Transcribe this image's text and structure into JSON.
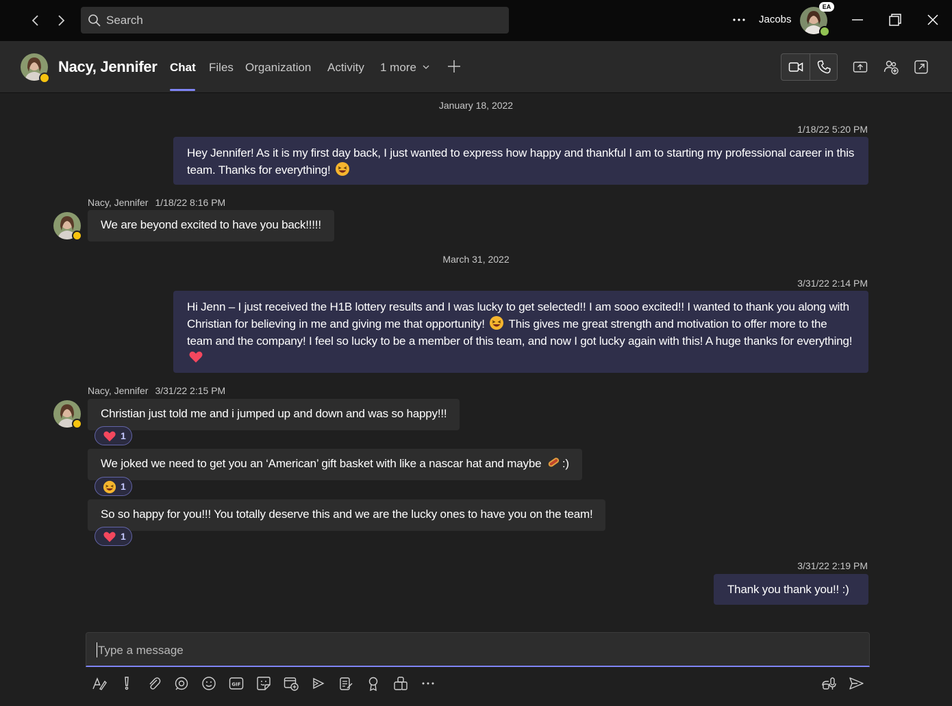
{
  "titlebar": {
    "search_placeholder": "Search",
    "username": "Jacobs",
    "user_initials": "EA",
    "icons": [
      "back-arrow-icon",
      "forward-arrow-icon",
      "search-icon",
      "more-options-icon",
      "minimize-icon",
      "restore-icon",
      "close-icon"
    ]
  },
  "header": {
    "contact_name": "Nacy, Jennifer",
    "tabs": [
      {
        "label": "Chat",
        "active": true
      },
      {
        "label": "Files",
        "active": false
      },
      {
        "label": "Organization",
        "active": false
      },
      {
        "label": "Activity",
        "active": false
      },
      {
        "label": "1 more",
        "active": false
      }
    ],
    "icons": [
      "add-tab-icon",
      "video-call-icon",
      "audio-call-icon",
      "share-screen-icon",
      "add-people-icon",
      "pop-out-icon"
    ]
  },
  "chat": {
    "date_1": "January 18, 2022",
    "msg1_time": "1/18/22 5:20 PM",
    "msg1_text_a": "Hey Jennifer! As it is my first day back, I just wanted to express how happy and thankful I am to starting my professional career in this team. Thanks for everything!",
    "msg2_sender": "Nacy, Jennifer",
    "msg2_time": "1/18/22 8:16 PM",
    "msg2_text": "We are beyond excited to have you back!!!!!",
    "date_2": "March 31, 2022",
    "msg3_time": "3/31/22 2:14 PM",
    "msg3_text_a": "Hi Jenn – I just received the H1B lottery results and I was lucky to get selected!! I am sooo excited!! I wanted to thank you along with Christian for believing in me and giving me that opportunity!",
    "msg3_text_b": "This gives me great strength and motivation to offer more to the team and the company! I feel so lucky to be a member of this team, and now I got lucky again with this! A huge thanks for everything!",
    "msg4_sender": "Nacy, Jennifer",
    "msg4_time": "3/31/22 2:15 PM",
    "msg4_text": "Christian just told me and i jumped up and down and was so happy!!!",
    "msg4_reaction_count": "1",
    "msg5_text_a": "We joked we need to get you an ‘American’ gift basket with like a nascar hat and maybe",
    "msg5_text_b": ":)",
    "msg5_reaction_count": "1",
    "msg6_text": "So so happy for you!!!  You totally deserve this and we are the lucky ones to have you on the team!",
    "msg6_reaction_count": "1",
    "msg7_time": "3/31/22 2:19 PM",
    "msg7_text": "Thank you thank you!! :)",
    "reaction_icons": [
      "heart-icon",
      "laughing-emoji-icon",
      "heart-icon"
    ]
  },
  "compose": {
    "placeholder": "Type a message",
    "toolbar_icons": [
      "format-icon",
      "important-icon",
      "attach-icon",
      "loop-icon",
      "emoji-icon",
      "gif-icon",
      "sticker-icon",
      "schedule-meeting-icon",
      "stream-icon",
      "praise-icon",
      "approvals-icon",
      "apps-icon",
      "more-tools-icon",
      "dictate-icon",
      "send-icon"
    ]
  },
  "colors": {
    "accent": "#7f85f5",
    "bubble_out": "#2f2f4a",
    "bubble_in": "#2d2d2d",
    "away": "#f8c40f",
    "available": "#92c353"
  }
}
